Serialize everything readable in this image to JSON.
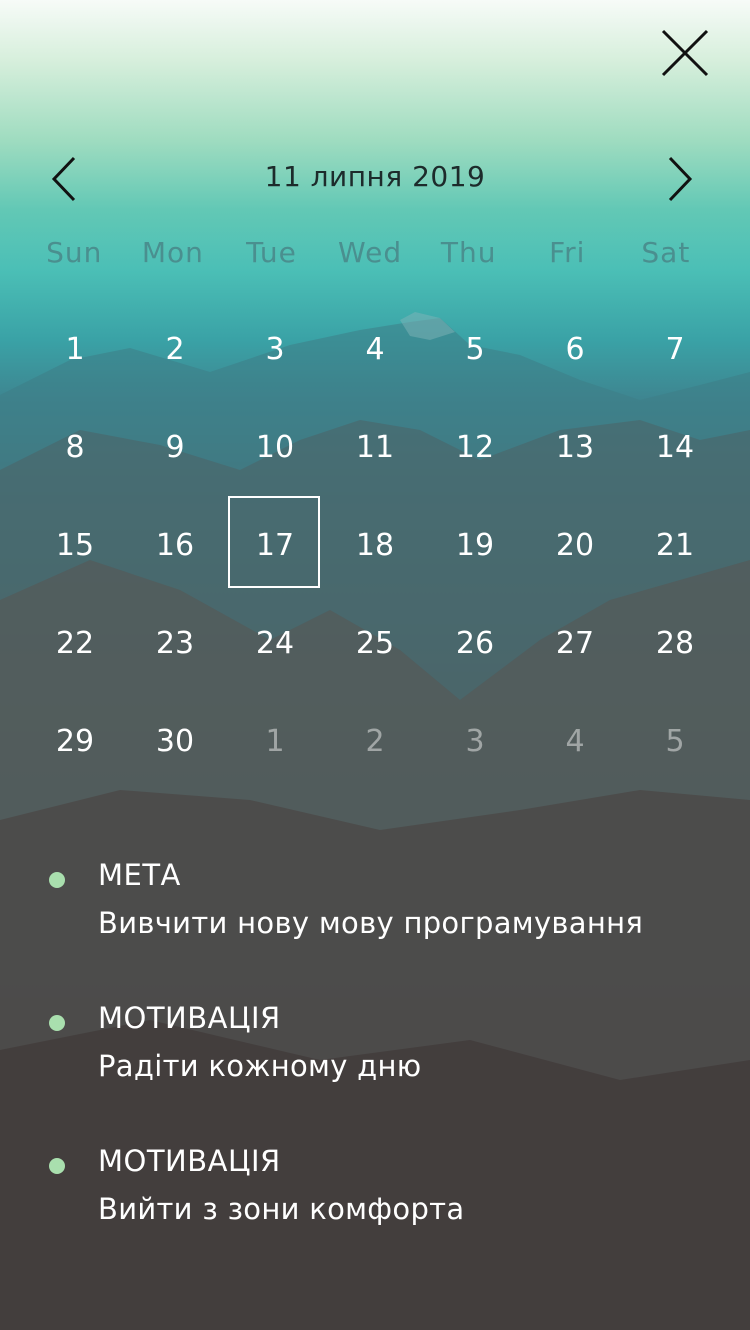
{
  "header": {
    "title": "11 липня 2019"
  },
  "weekdays": [
    "Sun",
    "Mon",
    "Tue",
    "Wed",
    "Thu",
    "Fri",
    "Sat"
  ],
  "days": [
    {
      "label": "1",
      "other": false,
      "selected": false
    },
    {
      "label": "2",
      "other": false,
      "selected": false
    },
    {
      "label": "3",
      "other": false,
      "selected": false
    },
    {
      "label": "4",
      "other": false,
      "selected": false
    },
    {
      "label": "5",
      "other": false,
      "selected": false
    },
    {
      "label": "6",
      "other": false,
      "selected": false
    },
    {
      "label": "7",
      "other": false,
      "selected": false
    },
    {
      "label": "8",
      "other": false,
      "selected": false
    },
    {
      "label": "9",
      "other": false,
      "selected": false
    },
    {
      "label": "10",
      "other": false,
      "selected": false
    },
    {
      "label": "11",
      "other": false,
      "selected": false
    },
    {
      "label": "12",
      "other": false,
      "selected": false
    },
    {
      "label": "13",
      "other": false,
      "selected": false
    },
    {
      "label": "14",
      "other": false,
      "selected": false
    },
    {
      "label": "15",
      "other": false,
      "selected": false
    },
    {
      "label": "16",
      "other": false,
      "selected": false
    },
    {
      "label": "17",
      "other": false,
      "selected": true
    },
    {
      "label": "18",
      "other": false,
      "selected": false
    },
    {
      "label": "19",
      "other": false,
      "selected": false
    },
    {
      "label": "20",
      "other": false,
      "selected": false
    },
    {
      "label": "21",
      "other": false,
      "selected": false
    },
    {
      "label": "22",
      "other": false,
      "selected": false
    },
    {
      "label": "23",
      "other": false,
      "selected": false
    },
    {
      "label": "24",
      "other": false,
      "selected": false
    },
    {
      "label": "25",
      "other": false,
      "selected": false
    },
    {
      "label": "26",
      "other": false,
      "selected": false
    },
    {
      "label": "27",
      "other": false,
      "selected": false
    },
    {
      "label": "28",
      "other": false,
      "selected": false
    },
    {
      "label": "29",
      "other": false,
      "selected": false
    },
    {
      "label": "30",
      "other": false,
      "selected": false
    },
    {
      "label": "1",
      "other": true,
      "selected": false
    },
    {
      "label": "2",
      "other": true,
      "selected": false
    },
    {
      "label": "3",
      "other": true,
      "selected": false
    },
    {
      "label": "4",
      "other": true,
      "selected": false
    },
    {
      "label": "5",
      "other": true,
      "selected": false
    }
  ],
  "events": [
    {
      "title": "МЕТА",
      "text": "Вивчити нову мову програмування"
    },
    {
      "title": "МОТИВАЦІЯ",
      "text": "Радіти кожному дню"
    },
    {
      "title": "МОТИВАЦІЯ",
      "text": "Вийти з зони комфорта"
    }
  ],
  "icons": {
    "close": "close-icon",
    "prev": "chevron-left-icon",
    "next": "chevron-right-icon"
  },
  "colors": {
    "accent_dot": "#a9dfae",
    "title_text": "#1d2b2b",
    "weekday_text": "#4a8f8f"
  }
}
